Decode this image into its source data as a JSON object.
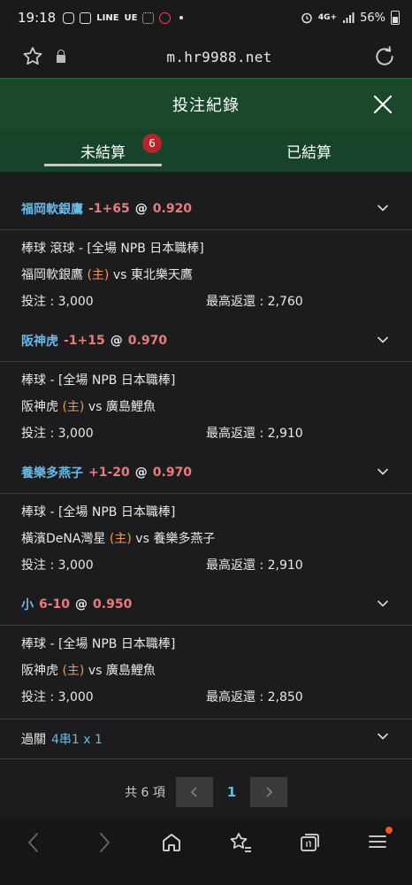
{
  "status_bar": {
    "time": "19:18",
    "right_text": "56%",
    "network": "4G+"
  },
  "browser": {
    "url": "m.hr9988.net"
  },
  "header": {
    "title": "投注紀錄"
  },
  "tabs": [
    {
      "label": "未結算",
      "badge": "6",
      "active": true
    },
    {
      "label": "已結算",
      "active": false
    }
  ],
  "bets": [
    {
      "team": "福岡軟銀鷹",
      "handicap": "-1+65",
      "at": "@",
      "odds": "0.920",
      "market": "棒球 滾球 - [全場 NPB 日本職棒]",
      "home_team": "福岡軟銀鷹",
      "home_tag": "(主)",
      "vs": "vs",
      "away_team": "東北樂天鷹",
      "stake": "投注 : 3,000",
      "max_return": "最高返還 : 2,760"
    },
    {
      "team": "阪神虎",
      "handicap": "-1+15",
      "at": "@",
      "odds": "0.970",
      "market": "棒球 - [全場 NPB 日本職棒]",
      "home_team": "阪神虎",
      "home_tag": "(主)",
      "vs": "vs",
      "away_team": "廣島鯉魚",
      "stake": "投注 : 3,000",
      "max_return": "最高返還 : 2,910"
    },
    {
      "team": "養樂多燕子",
      "handicap": "+1-20",
      "at": "@",
      "odds": "0.970",
      "market": "棒球 - [全場 NPB 日本職棒]",
      "home_team": "橫濱DeNA灣星",
      "home_tag": "(主)",
      "vs": "vs",
      "away_team": "養樂多燕子",
      "stake": "投注 : 3,000",
      "max_return": "最高返還 : 2,910"
    },
    {
      "team": "小",
      "handicap": "6-10",
      "at": "@",
      "odds": "0.950",
      "market": "棒球 - [全場 NPB 日本職棒]",
      "home_team": "阪神虎",
      "home_tag": "(主)",
      "vs": "vs",
      "away_team": "廣島鯉魚",
      "stake": "投注 : 3,000",
      "max_return": "最高返還 : 2,850"
    }
  ],
  "parlay": {
    "label": "過關",
    "value": "4串1 x 1"
  },
  "pagination": {
    "total": "共 6 項",
    "current_page": "1"
  },
  "colors": {
    "header_bg": "#19492a",
    "team_blue": "#6bb8e6",
    "odds_red": "#e87c7c",
    "home_orange": "#e89a5a",
    "badge_red": "#b5262c"
  }
}
